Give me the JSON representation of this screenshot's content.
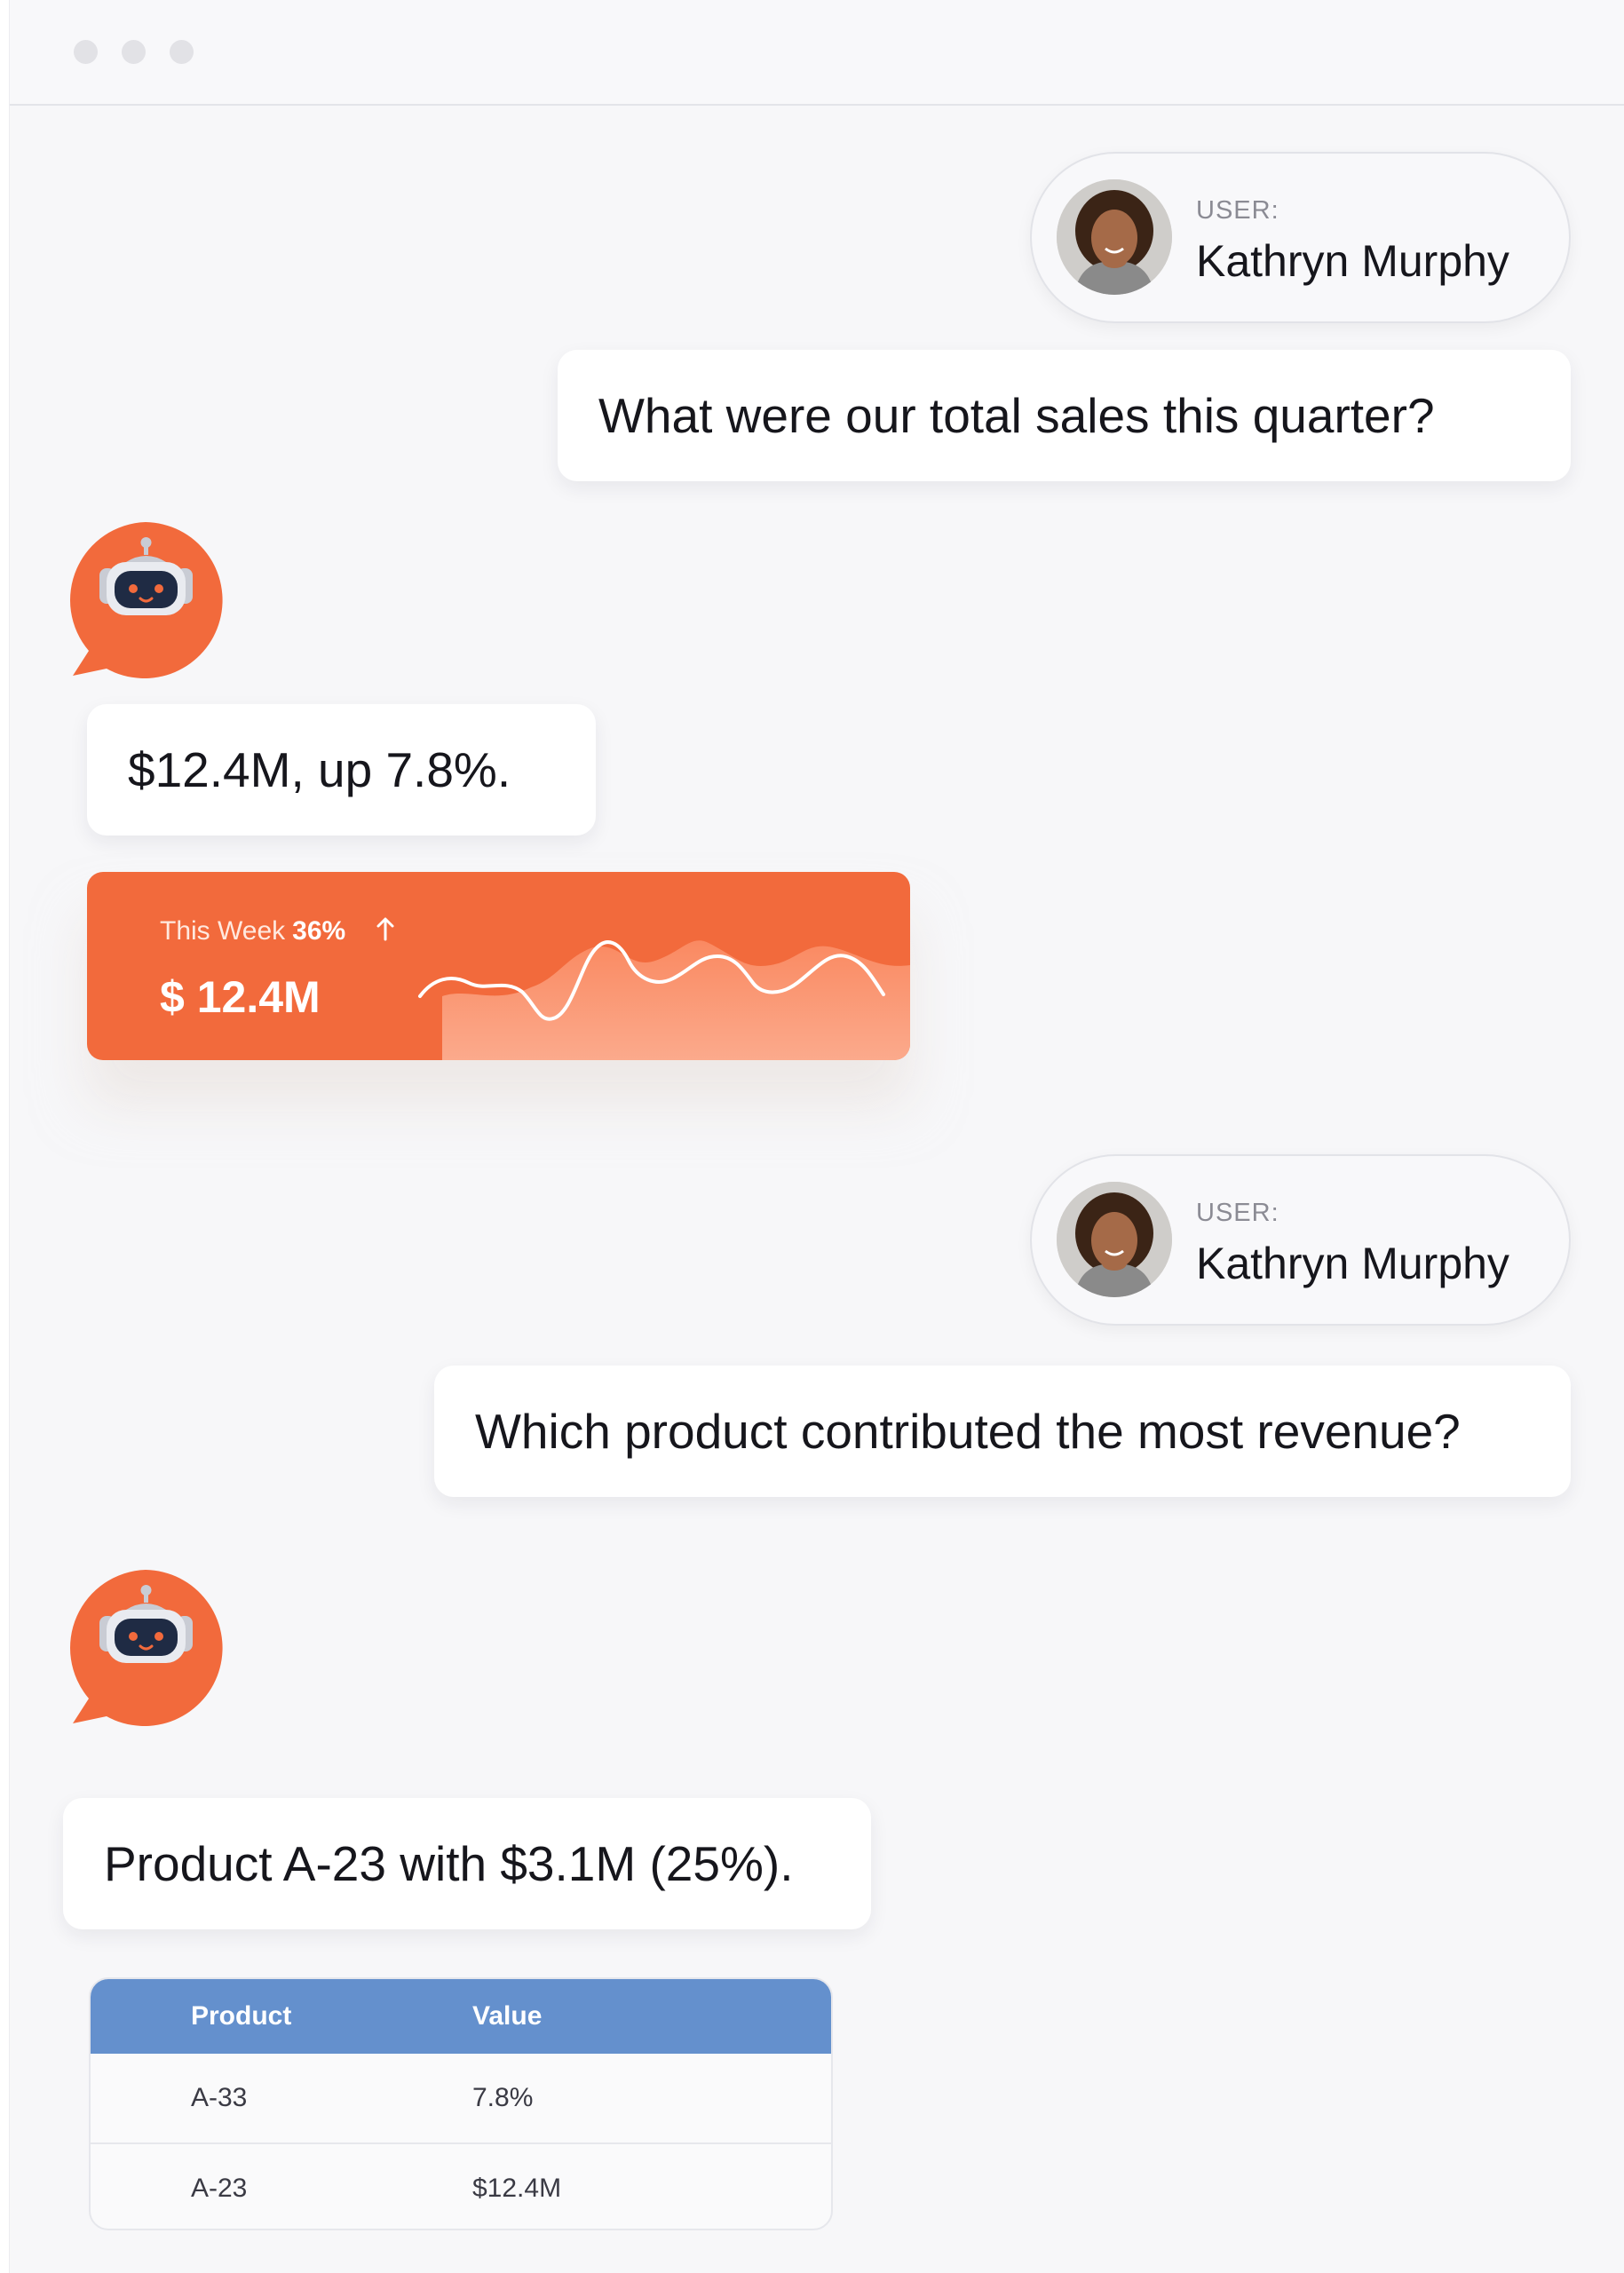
{
  "window": {
    "controls": [
      "close",
      "minimize",
      "maximize"
    ]
  },
  "conversation": {
    "user_label": "USER:",
    "user_name": "Kathryn Murphy",
    "messages": [
      {
        "role": "user",
        "text": "What were our total sales this quarter?"
      },
      {
        "role": "assistant",
        "text": "$12.4M, up 7.8%."
      },
      {
        "role": "user",
        "text": "Which product contributed the most revenue?"
      },
      {
        "role": "assistant",
        "text": "Product A-23 with $3.1M (25%)."
      }
    ]
  },
  "stat_card": {
    "label": "This Week",
    "change": "36%",
    "value": "$ 12.4M",
    "trend": "up",
    "accent": "#f26a3c"
  },
  "table": {
    "headers": [
      "Product",
      "Value"
    ],
    "rows": [
      [
        "A-33",
        "7.8%"
      ],
      [
        "A-23",
        "$12.4M"
      ]
    ],
    "header_color": "#6490cd"
  },
  "colors": {
    "background": "#f7f7f9",
    "bot_accent": "#f26a3c"
  }
}
